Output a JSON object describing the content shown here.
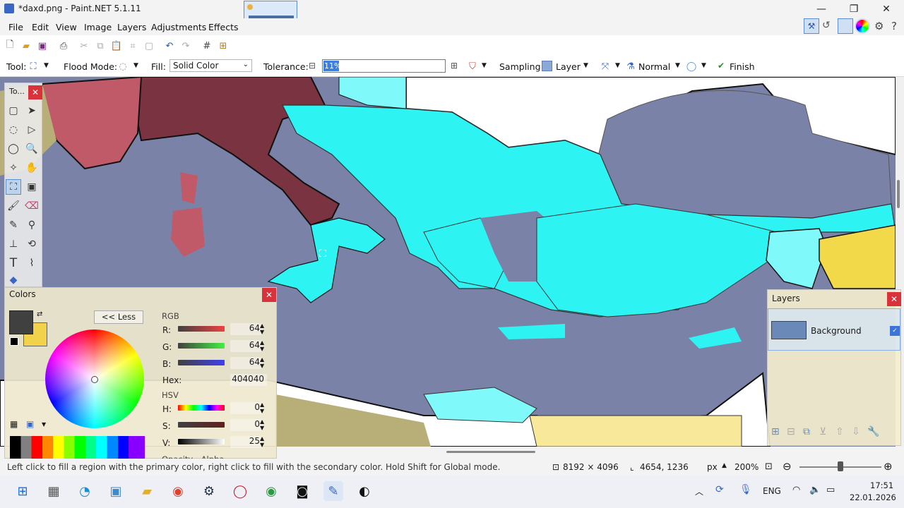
{
  "window": {
    "title": "*daxd.png - Paint.NET 5.1.11"
  },
  "menu": [
    "File",
    "Edit",
    "View",
    "Image",
    "Layers",
    "Adjustments",
    "Effects"
  ],
  "toolbar": {
    "tool_label": "Tool:",
    "flood_mode_label": "Flood Mode:",
    "fill_label": "Fill:",
    "fill_value": "Solid Color",
    "tolerance_label": "Tolerance:",
    "tolerance_value": "11%",
    "sampling_label": "Sampling:",
    "sampling_value": "Layer",
    "blend_value": "Normal",
    "finish_label": "Finish"
  },
  "tools_panel": {
    "title": "To..."
  },
  "colors_panel": {
    "title": "Colors",
    "less_button": "<< Less",
    "rgb_label": "RGB",
    "r_label": "R:",
    "r_value": "64",
    "g_label": "G:",
    "g_value": "64",
    "b_label": "B:",
    "b_value": "64",
    "hex_label": "Hex:",
    "hex_value": "404040",
    "hsv_label": "HSV",
    "h_label": "H:",
    "h_value": "0",
    "s_label": "S:",
    "s_value": "0",
    "v_label": "V:",
    "v_value": "25",
    "opacity_label": "Opacity - Alpha",
    "primary_color": "#404040",
    "secondary_color": "#f2d24a"
  },
  "layers_panel": {
    "title": "Layers",
    "layer_name": "Background"
  },
  "status": {
    "message": "Left click to fill a region with the primary color, right click to fill with the secondary color. Hold Shift for Global mode.",
    "image_size": "8192 × 4096",
    "cursor_pos": "4654, 1236",
    "unit": "px",
    "zoom": "200%"
  },
  "taskbar": {
    "lang": "ENG",
    "time": "17:51",
    "date": "22.01.2026"
  }
}
